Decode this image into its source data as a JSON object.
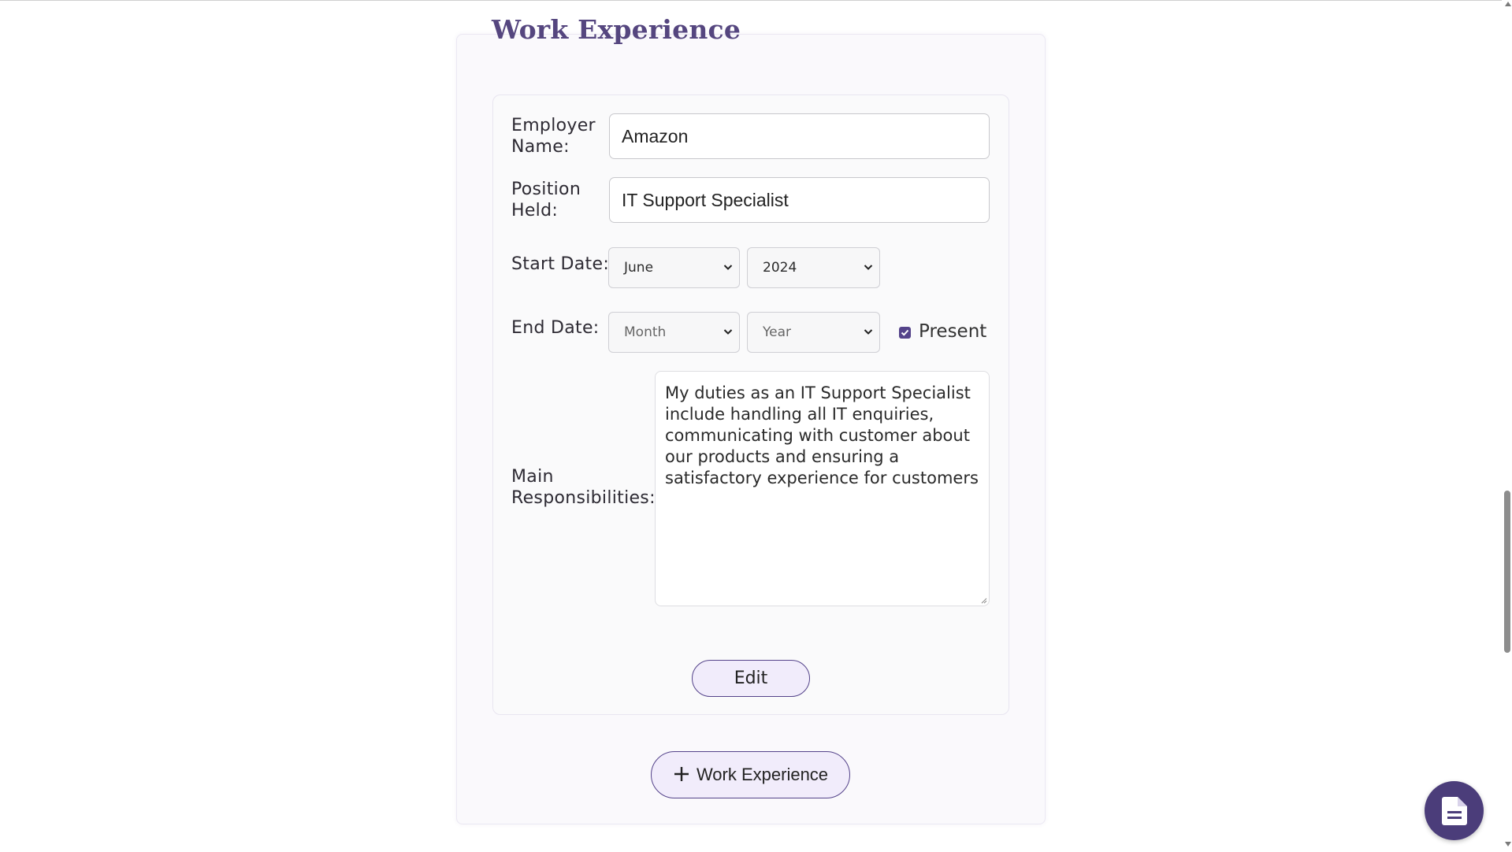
{
  "section": {
    "title": "Work Experience"
  },
  "entry": {
    "employer_label": "Employer Name:",
    "employer_label_line1": "Employer",
    "employer_label_line2": "Name:",
    "employer_value": "Amazon",
    "position_label_line1": "Position",
    "position_label_line2": "Held:",
    "position_value": "IT Support Specialist",
    "start_label": "Start Date:",
    "start_month": "June",
    "start_year": "2024",
    "end_label": "End Date:",
    "end_month": "Month",
    "end_year": "Year",
    "present_label": "Present",
    "present_checked": true,
    "responsibilities_label_line1": "Main",
    "responsibilities_label_line2": "Responsibilities:",
    "responsibilities_value": "My duties as an IT Support Specialist include handling all IT enquiries, communicating with customer about our products and ensuring a satisfactory experience for customers",
    "edit_label": "Edit"
  },
  "add_button": {
    "label": "Work Experience"
  },
  "fab": {
    "icon": "document-icon"
  },
  "colors": {
    "accent": "#54438a",
    "title": "#55467f",
    "button_bg": "#f1ecfb",
    "fab_bg": "#4b3d7a"
  }
}
